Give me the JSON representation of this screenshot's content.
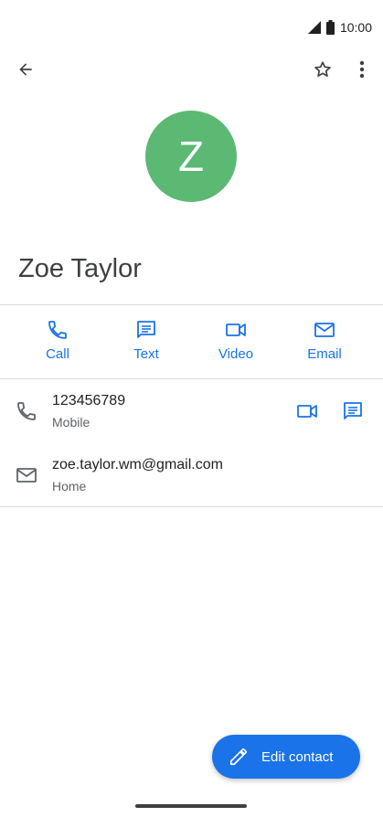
{
  "status_bar": {
    "time": "10:00"
  },
  "header": {},
  "contact": {
    "initial": "Z",
    "name": "Zoe Taylor",
    "avatar_color": "#5bb974"
  },
  "actions": [
    {
      "label": "Call",
      "icon": "phone-icon"
    },
    {
      "label": "Text",
      "icon": "message-icon"
    },
    {
      "label": "Video",
      "icon": "video-icon"
    },
    {
      "label": "Email",
      "icon": "email-icon"
    }
  ],
  "details": {
    "phone": {
      "value": "123456789",
      "type": "Mobile"
    },
    "email": {
      "value": "zoe.taylor.wm@gmail.com",
      "type": "Home"
    }
  },
  "fab": {
    "label": "Edit contact"
  },
  "colors": {
    "accent": "#1a73e8",
    "divider": "#dadce0",
    "text": "#202124"
  }
}
